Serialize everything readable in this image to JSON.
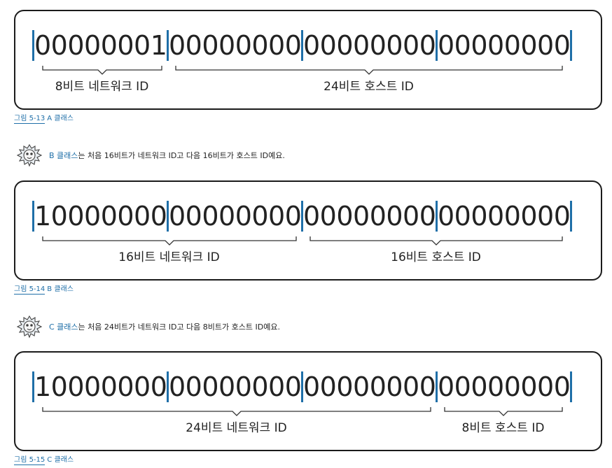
{
  "figures": [
    {
      "octets": [
        "00000001",
        "00000000",
        "00000000",
        "00000000"
      ],
      "network_octets": 1,
      "network_label": "8비트 네트워크 ID",
      "host_label": "24비트 호스트 ID",
      "caption_number": "그림 5-13",
      "caption_text": "A 클래스"
    },
    {
      "octets": [
        "10000000",
        "00000000",
        "00000000",
        "00000000"
      ],
      "network_octets": 2,
      "network_label": "16비트 네트워크 ID",
      "host_label": "16비트 호스트 ID",
      "caption_number": "그림 5-14",
      "caption_text": "B 클래스"
    },
    {
      "octets": [
        "10000000",
        "00000000",
        "00000000",
        "00000000"
      ],
      "network_octets": 3,
      "network_label": "24비트 네트워크 ID",
      "host_label": "8비트 호스트 ID",
      "caption_number": "그림 5-15",
      "caption_text": "C 클래스"
    }
  ],
  "notes": [
    {
      "highlight": "B 클래스",
      "text": "는 처음 16비트가 네트워크 ID고 다음 16비트가 호스트 ID예요."
    },
    {
      "highlight": "C 클래스",
      "text": "는 처음 24비트가 네트워크 ID고 다음 8비트가 호스트 ID예요."
    }
  ],
  "colors": {
    "accent": "#1f6fa8",
    "text": "#222222",
    "border": "#1b1b1b"
  },
  "icons": {
    "mascot": "lion-mascot-icon"
  }
}
